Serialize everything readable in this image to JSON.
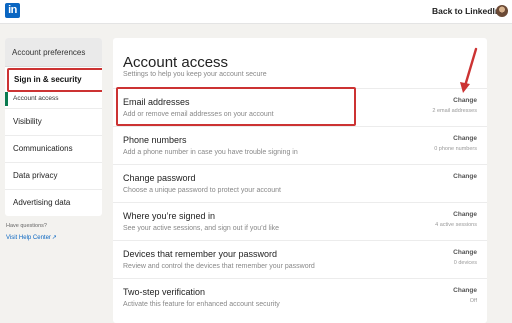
{
  "header": {
    "logo_text": "in",
    "back_link": "Back to LinkedIn"
  },
  "sidebar": {
    "heading": "Account preferences",
    "active_item": "Sign in & security",
    "sub_item": "Account access",
    "items": [
      {
        "label": "Visibility"
      },
      {
        "label": "Communications"
      },
      {
        "label": "Data privacy"
      },
      {
        "label": "Advertising data"
      }
    ],
    "help_question": "Have questions?",
    "help_link": "Visit Help Center"
  },
  "main": {
    "title": "Account access",
    "subtitle": "Settings to help you keep your account secure",
    "rows": [
      {
        "title": "Email addresses",
        "description": "Add or remove email addresses on your account",
        "action": "Change",
        "meta": "2 email addresses"
      },
      {
        "title": "Phone numbers",
        "description": "Add a phone number in case you have trouble signing in",
        "action": "Change",
        "meta": "0 phone numbers"
      },
      {
        "title": "Change password",
        "description": "Choose a unique password to protect your account",
        "action": "Change",
        "meta": ""
      },
      {
        "title": "Where you’re signed in",
        "description": "See your active sessions, and sign out if you’d like",
        "action": "Change",
        "meta": "4 active sessions"
      },
      {
        "title": "Devices that remember your password",
        "description": "Review and control the devices that remember your password",
        "action": "Change",
        "meta": "0 devices"
      },
      {
        "title": "Two-step verification",
        "description": "Activate this feature for enhanced account security",
        "action": "Change",
        "meta": "Off"
      }
    ]
  },
  "colors": {
    "brand": "#0a66c2",
    "highlight": "#cc3333",
    "active_marker": "#0a7a4f"
  }
}
